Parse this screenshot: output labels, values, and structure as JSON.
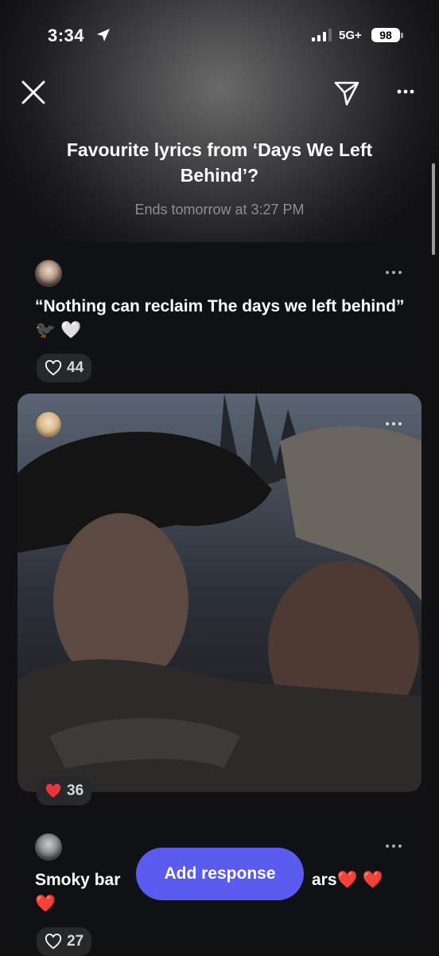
{
  "status_bar": {
    "time": "3:34",
    "network": "5G+",
    "battery": "98"
  },
  "poll": {
    "title": "Favourite lyrics from ‘Days We Left Behind’?",
    "subtitle": "Ends tomorrow at 3:27 PM"
  },
  "responses": [
    {
      "text": "“Nothing can reclaim The days we left behind” 🐦‍⬛ 🤍",
      "likes": "44",
      "liked": false
    },
    {
      "text": "",
      "likes": "36",
      "liked": true
    },
    {
      "text": "Smoky bar",
      "text_end": "ars❤️ ❤️",
      "text_line2": "❤️",
      "likes": "27",
      "liked": false
    }
  ],
  "add_response_label": "Add response",
  "colors": {
    "accent": "#5a5cf0",
    "liked_heart": "#e5363d",
    "card": "#0f1114"
  }
}
